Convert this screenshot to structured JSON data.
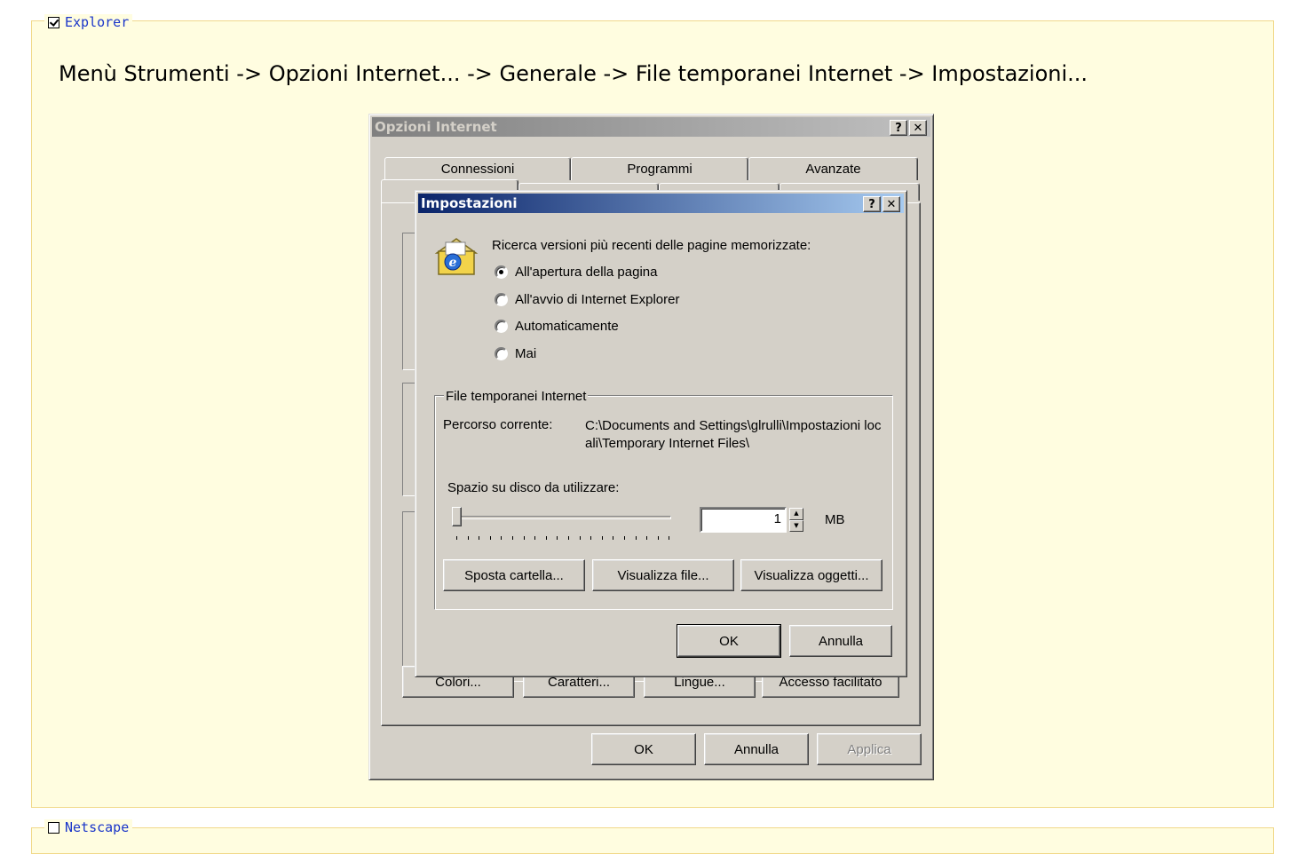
{
  "sections": {
    "explorer": {
      "label": "Explorer",
      "checked": true
    },
    "netscape": {
      "label": "Netscape",
      "checked": false
    }
  },
  "instruction_path": "Menù Strumenti -> Opzioni Internet... -> Generale -> File temporanei Internet -> Impostazioni...",
  "outer_dialog": {
    "title": "Opzioni Internet",
    "help_button": "?",
    "close_button": "✕",
    "tabs_back": [
      "Connessioni",
      "Programmi",
      "Avanzate"
    ],
    "bottom_buttons": [
      "Colori...",
      "Caratteri...",
      "Lingue...",
      "Accesso facilitato"
    ],
    "ok": "OK",
    "cancel": "Annulla",
    "apply": "Applica"
  },
  "inner_dialog": {
    "title": "Impostazioni",
    "help_button": "?",
    "close_button": "✕",
    "check_label": "Ricerca versioni più recenti delle pagine memorizzate:",
    "options": [
      {
        "label": "All'apertura della pagina",
        "selected": true
      },
      {
        "label": "All'avvio di Internet Explorer",
        "selected": false
      },
      {
        "label": "Automaticamente",
        "selected": false
      },
      {
        "label": "Mai",
        "selected": false
      }
    ],
    "group_title": "File temporanei Internet",
    "current_path_label": "Percorso corrente:",
    "current_path_value": "C:\\Documents and Settings\\glrulli\\Impostazioni locali\\Temporary Internet Files\\",
    "disk_space_label": "Spazio su disco da utilizzare:",
    "disk_space_value": "1",
    "disk_space_unit": "MB",
    "slider_level": 0,
    "move_folder": "Sposta cartella...",
    "view_files": "Visualizza file...",
    "view_objects": "Visualizza oggetti...",
    "ok": "OK",
    "cancel": "Annulla"
  }
}
